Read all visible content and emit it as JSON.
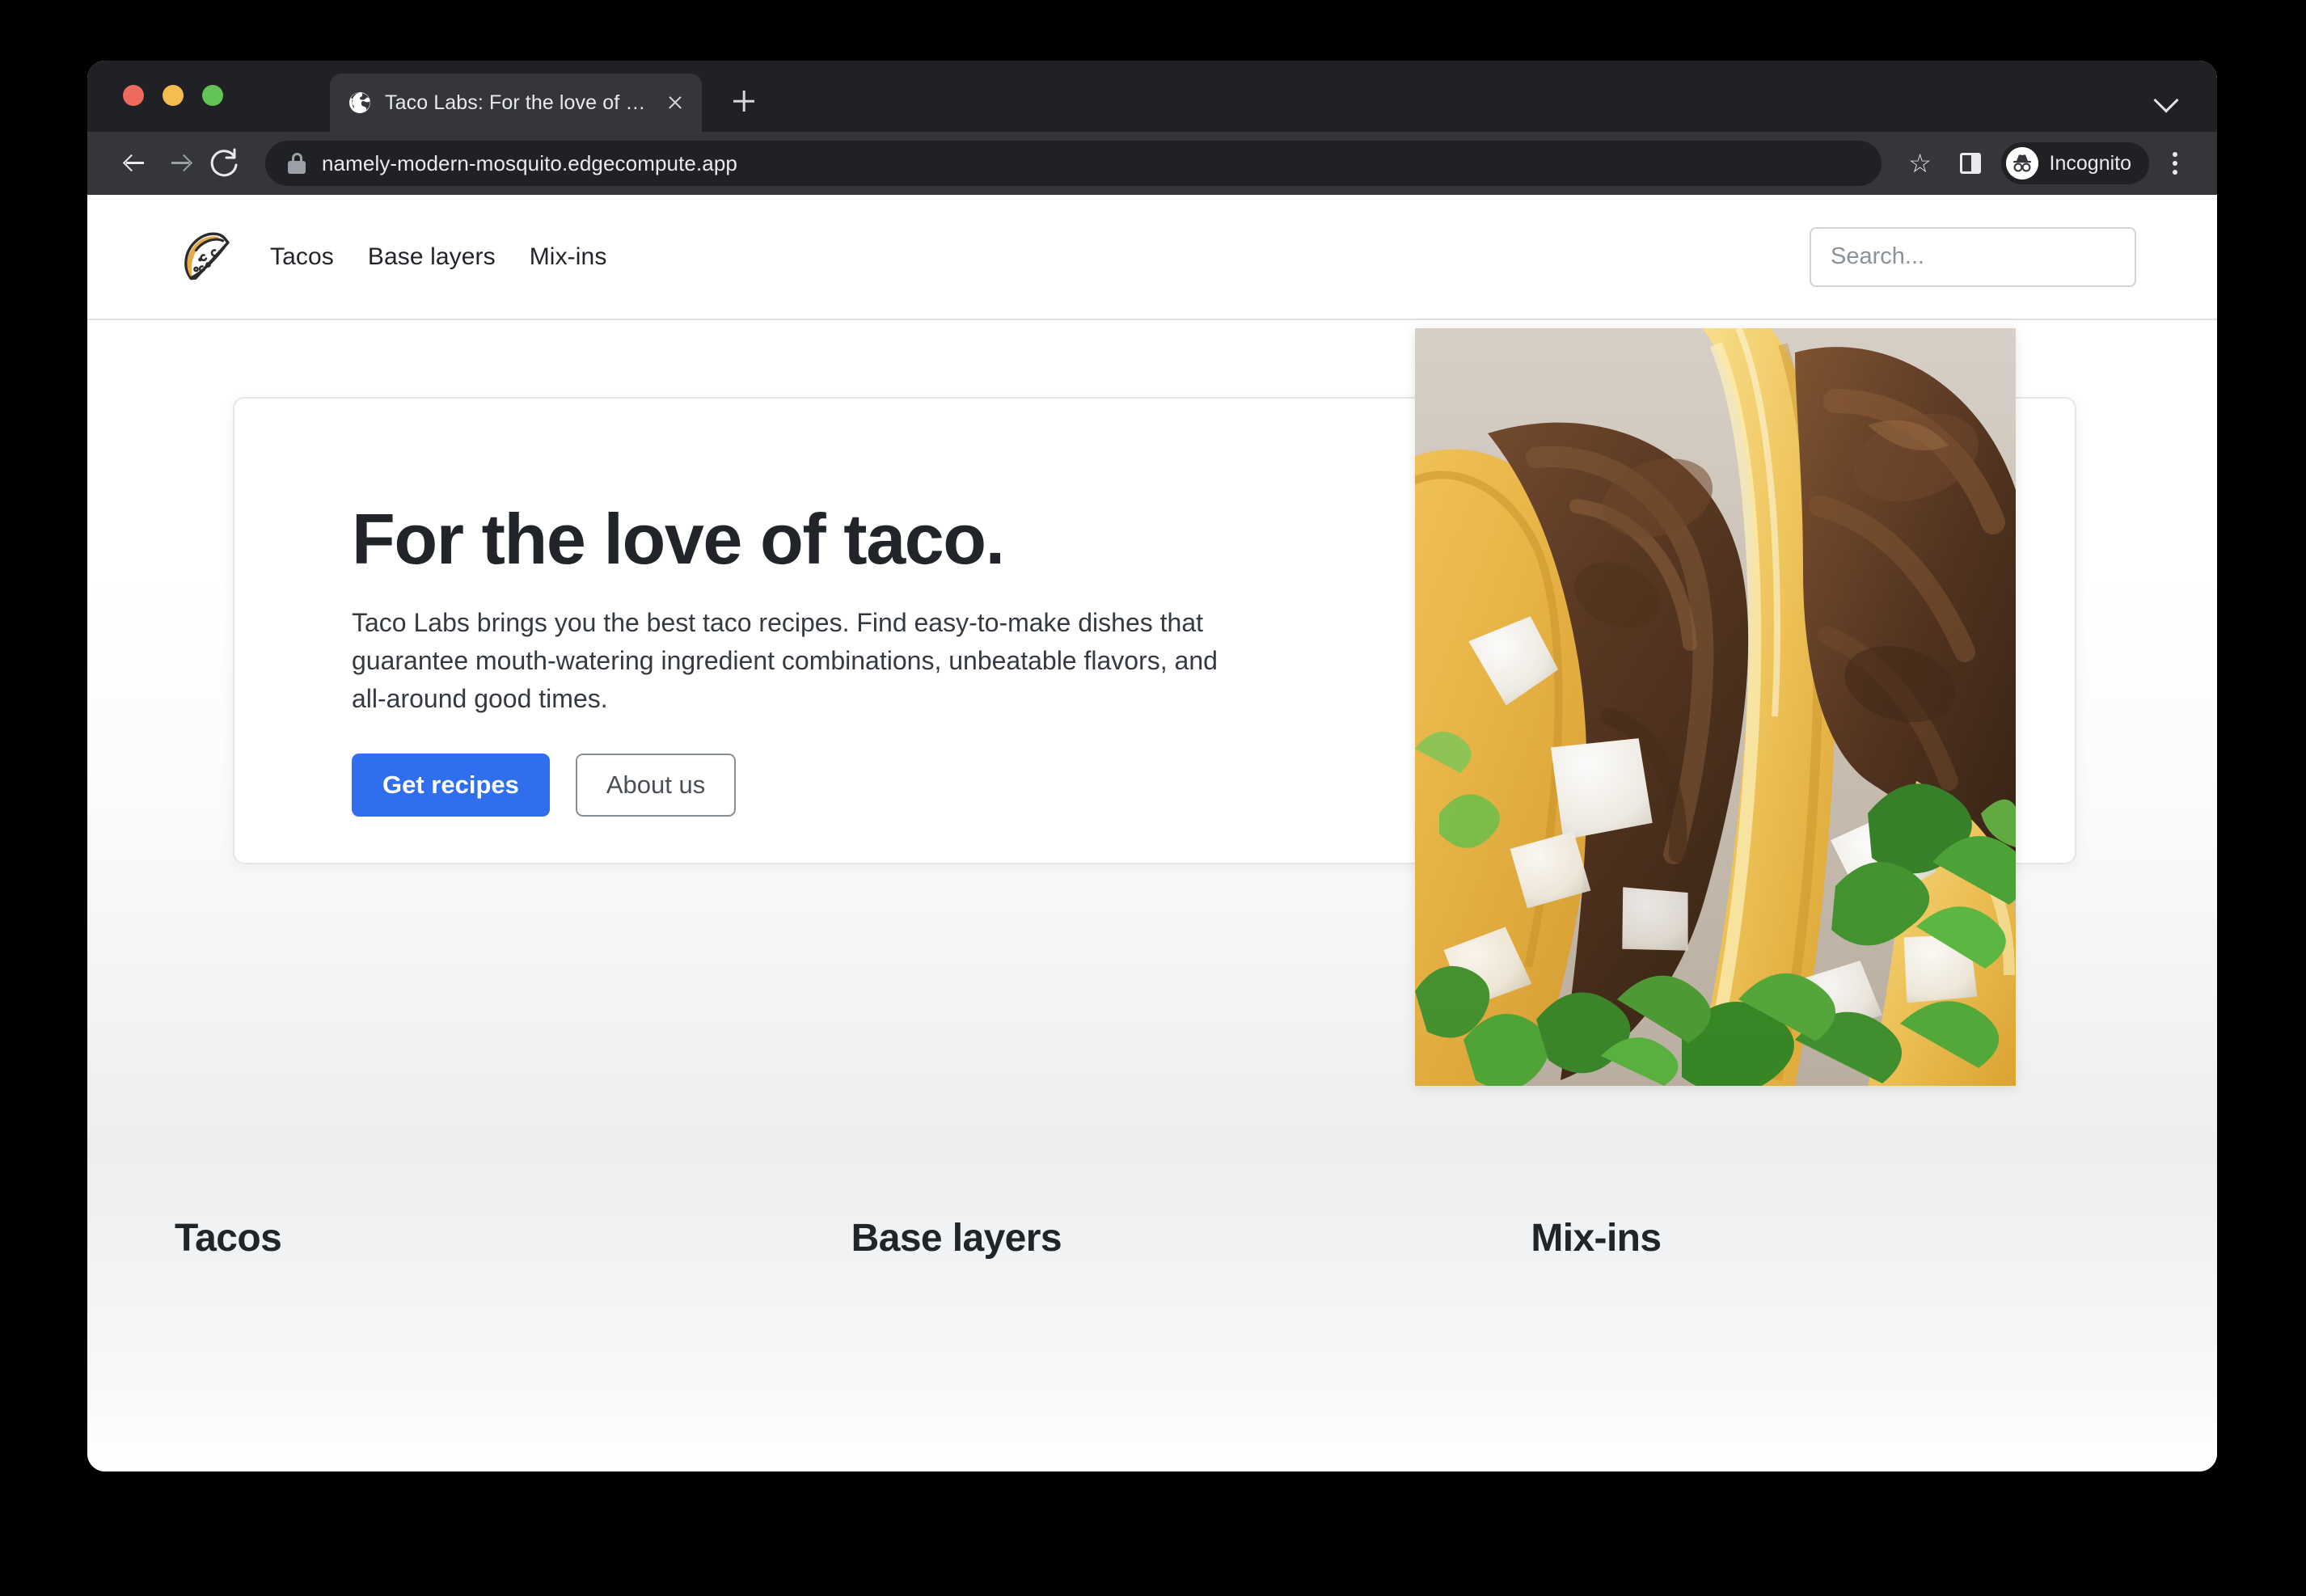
{
  "browser": {
    "tab": {
      "title": "Taco Labs: For the love of taco",
      "favicon_icon": "globe-icon",
      "close_icon": "close-icon"
    },
    "new_tab_icon": "plus-icon",
    "tabstrip_chevron_icon": "chevron-down-icon",
    "toolbar": {
      "back_icon": "arrow-left-icon",
      "forward_icon": "arrow-right-icon",
      "reload_icon": "reload-icon",
      "lock_icon": "lock-icon",
      "url": "namely-modern-mosquito.edgecompute.app",
      "bookmark_icon": "star-icon",
      "side_panel_icon": "side-panel-icon",
      "profile_label": "Incognito",
      "profile_icon": "incognito-icon",
      "menu_icon": "kebab-menu-icon"
    },
    "traffic_lights": {
      "close_color": "#ed6a5e",
      "minimize_color": "#f5bd4f",
      "maximize_color": "#61c454"
    },
    "chrome_colors": {
      "tabstrip_bg": "#202124",
      "toolbar_bg": "#35363a",
      "active_tab_bg": "#35363a",
      "omnibox_bg": "#202124",
      "text": "#e8eaed"
    }
  },
  "site": {
    "logo_icon": "taco-logo-icon",
    "nav": [
      {
        "label": "Tacos"
      },
      {
        "label": "Base layers"
      },
      {
        "label": "Mix-ins"
      }
    ],
    "search": {
      "placeholder": "Search...",
      "value": ""
    }
  },
  "hero": {
    "title": "For the love of taco.",
    "subtitle": "Taco Labs brings you the best taco recipes. Find easy-to-make dishes that guarantee mouth-watering ingredient combinations, unbeatable flavors, and all-around good times.",
    "primary_button": "Get recipes",
    "secondary_button": "About us",
    "image_alt": "street-tacos-photo",
    "accent_color": "#2f6fed"
  },
  "categories": [
    {
      "title": "Tacos"
    },
    {
      "title": "Base layers"
    },
    {
      "title": "Mix-ins"
    }
  ]
}
